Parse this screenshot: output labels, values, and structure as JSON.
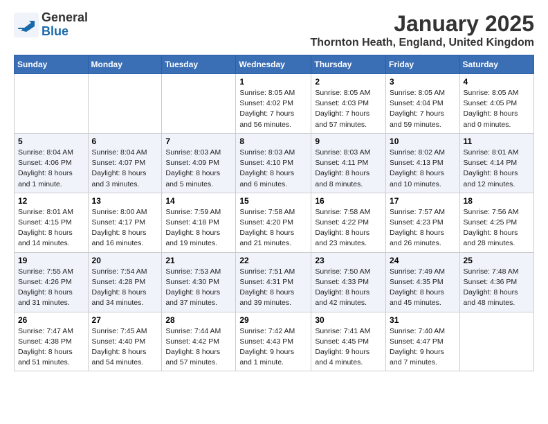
{
  "logo": {
    "general": "General",
    "blue": "Blue"
  },
  "title": "January 2025",
  "location": "Thornton Heath, England, United Kingdom",
  "days_of_week": [
    "Sunday",
    "Monday",
    "Tuesday",
    "Wednesday",
    "Thursday",
    "Friday",
    "Saturday"
  ],
  "weeks": [
    [
      {
        "day": "",
        "info": ""
      },
      {
        "day": "",
        "info": ""
      },
      {
        "day": "",
        "info": ""
      },
      {
        "day": "1",
        "info": "Sunrise: 8:05 AM\nSunset: 4:02 PM\nDaylight: 7 hours and 56 minutes."
      },
      {
        "day": "2",
        "info": "Sunrise: 8:05 AM\nSunset: 4:03 PM\nDaylight: 7 hours and 57 minutes."
      },
      {
        "day": "3",
        "info": "Sunrise: 8:05 AM\nSunset: 4:04 PM\nDaylight: 7 hours and 59 minutes."
      },
      {
        "day": "4",
        "info": "Sunrise: 8:05 AM\nSunset: 4:05 PM\nDaylight: 8 hours and 0 minutes."
      }
    ],
    [
      {
        "day": "5",
        "info": "Sunrise: 8:04 AM\nSunset: 4:06 PM\nDaylight: 8 hours and 1 minute."
      },
      {
        "day": "6",
        "info": "Sunrise: 8:04 AM\nSunset: 4:07 PM\nDaylight: 8 hours and 3 minutes."
      },
      {
        "day": "7",
        "info": "Sunrise: 8:03 AM\nSunset: 4:09 PM\nDaylight: 8 hours and 5 minutes."
      },
      {
        "day": "8",
        "info": "Sunrise: 8:03 AM\nSunset: 4:10 PM\nDaylight: 8 hours and 6 minutes."
      },
      {
        "day": "9",
        "info": "Sunrise: 8:03 AM\nSunset: 4:11 PM\nDaylight: 8 hours and 8 minutes."
      },
      {
        "day": "10",
        "info": "Sunrise: 8:02 AM\nSunset: 4:13 PM\nDaylight: 8 hours and 10 minutes."
      },
      {
        "day": "11",
        "info": "Sunrise: 8:01 AM\nSunset: 4:14 PM\nDaylight: 8 hours and 12 minutes."
      }
    ],
    [
      {
        "day": "12",
        "info": "Sunrise: 8:01 AM\nSunset: 4:15 PM\nDaylight: 8 hours and 14 minutes."
      },
      {
        "day": "13",
        "info": "Sunrise: 8:00 AM\nSunset: 4:17 PM\nDaylight: 8 hours and 16 minutes."
      },
      {
        "day": "14",
        "info": "Sunrise: 7:59 AM\nSunset: 4:18 PM\nDaylight: 8 hours and 19 minutes."
      },
      {
        "day": "15",
        "info": "Sunrise: 7:58 AM\nSunset: 4:20 PM\nDaylight: 8 hours and 21 minutes."
      },
      {
        "day": "16",
        "info": "Sunrise: 7:58 AM\nSunset: 4:22 PM\nDaylight: 8 hours and 23 minutes."
      },
      {
        "day": "17",
        "info": "Sunrise: 7:57 AM\nSunset: 4:23 PM\nDaylight: 8 hours and 26 minutes."
      },
      {
        "day": "18",
        "info": "Sunrise: 7:56 AM\nSunset: 4:25 PM\nDaylight: 8 hours and 28 minutes."
      }
    ],
    [
      {
        "day": "19",
        "info": "Sunrise: 7:55 AM\nSunset: 4:26 PM\nDaylight: 8 hours and 31 minutes."
      },
      {
        "day": "20",
        "info": "Sunrise: 7:54 AM\nSunset: 4:28 PM\nDaylight: 8 hours and 34 minutes."
      },
      {
        "day": "21",
        "info": "Sunrise: 7:53 AM\nSunset: 4:30 PM\nDaylight: 8 hours and 37 minutes."
      },
      {
        "day": "22",
        "info": "Sunrise: 7:51 AM\nSunset: 4:31 PM\nDaylight: 8 hours and 39 minutes."
      },
      {
        "day": "23",
        "info": "Sunrise: 7:50 AM\nSunset: 4:33 PM\nDaylight: 8 hours and 42 minutes."
      },
      {
        "day": "24",
        "info": "Sunrise: 7:49 AM\nSunset: 4:35 PM\nDaylight: 8 hours and 45 minutes."
      },
      {
        "day": "25",
        "info": "Sunrise: 7:48 AM\nSunset: 4:36 PM\nDaylight: 8 hours and 48 minutes."
      }
    ],
    [
      {
        "day": "26",
        "info": "Sunrise: 7:47 AM\nSunset: 4:38 PM\nDaylight: 8 hours and 51 minutes."
      },
      {
        "day": "27",
        "info": "Sunrise: 7:45 AM\nSunset: 4:40 PM\nDaylight: 8 hours and 54 minutes."
      },
      {
        "day": "28",
        "info": "Sunrise: 7:44 AM\nSunset: 4:42 PM\nDaylight: 8 hours and 57 minutes."
      },
      {
        "day": "29",
        "info": "Sunrise: 7:42 AM\nSunset: 4:43 PM\nDaylight: 9 hours and 1 minute."
      },
      {
        "day": "30",
        "info": "Sunrise: 7:41 AM\nSunset: 4:45 PM\nDaylight: 9 hours and 4 minutes."
      },
      {
        "day": "31",
        "info": "Sunrise: 7:40 AM\nSunset: 4:47 PM\nDaylight: 9 hours and 7 minutes."
      },
      {
        "day": "",
        "info": ""
      }
    ]
  ]
}
